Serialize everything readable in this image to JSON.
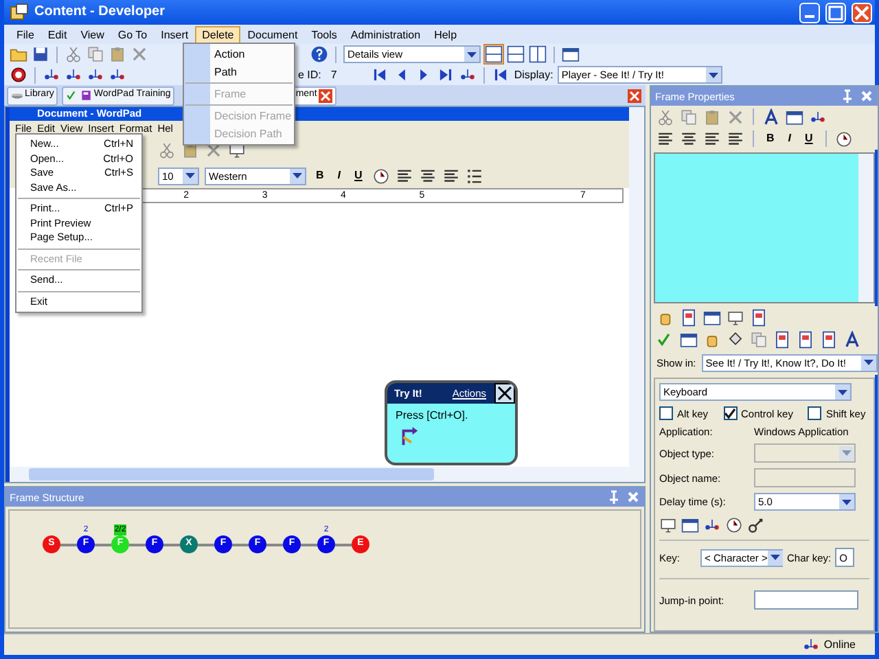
{
  "window": {
    "title": "Content - Developer"
  },
  "menu": [
    {
      "label": "File",
      "selected": false
    },
    {
      "label": "Edit",
      "selected": false
    },
    {
      "label": "View",
      "selected": false
    },
    {
      "label": "Go To",
      "selected": false
    },
    {
      "label": "Insert",
      "selected": false
    },
    {
      "label": "Delete",
      "selected": true
    },
    {
      "label": "Document",
      "selected": false
    },
    {
      "label": "Tools",
      "selected": false
    },
    {
      "label": "Administration",
      "selected": false
    },
    {
      "label": "Help",
      "selected": false
    }
  ],
  "delete_menu": [
    {
      "kind": "item",
      "label": "Action",
      "disabled": false
    },
    {
      "kind": "item",
      "label": "Path",
      "disabled": false
    },
    {
      "kind": "separator"
    },
    {
      "kind": "item",
      "label": "Frame",
      "disabled": true
    },
    {
      "kind": "separator"
    },
    {
      "kind": "item",
      "label": "Decision Frame",
      "disabled": true
    },
    {
      "kind": "item",
      "label": "Decision Path",
      "disabled": true
    }
  ],
  "toolbar": {
    "view_select": "Details view"
  },
  "toolbar2": {
    "id_label": "e ID:",
    "id_value": "7",
    "display_label": "Display:",
    "display_value": "Player - See It! / Try It!"
  },
  "nav_buttons": [
    "Library",
    "WordPad Training"
  ],
  "document_tab": {
    "label": "ment"
  },
  "wordpad": {
    "title": "Document - WordPad",
    "menu": [
      "File",
      "Edit",
      "View",
      "Insert",
      "Format",
      "Hel"
    ],
    "file_menu": [
      {
        "kind": "item",
        "label": "New...",
        "shortcut": "Ctrl+N",
        "disabled": false
      },
      {
        "kind": "item",
        "label": "Open...",
        "shortcut": "Ctrl+O",
        "disabled": false
      },
      {
        "kind": "item",
        "label": "Save",
        "shortcut": "Ctrl+S",
        "disabled": false
      },
      {
        "kind": "item",
        "label": "Save As...",
        "disabled": false
      },
      {
        "kind": "separator"
      },
      {
        "kind": "item",
        "label": "Print...",
        "shortcut": "Ctrl+P",
        "disabled": false
      },
      {
        "kind": "item",
        "label": "Print Preview",
        "disabled": false
      },
      {
        "kind": "item",
        "label": "Page Setup...",
        "disabled": false
      },
      {
        "kind": "separator"
      },
      {
        "kind": "item",
        "label": "Recent File",
        "disabled": true
      },
      {
        "kind": "separator"
      },
      {
        "kind": "item",
        "label": "Send...",
        "disabled": false
      },
      {
        "kind": "separator"
      },
      {
        "kind": "item",
        "label": "Exit",
        "disabled": false
      }
    ],
    "font_size": "10",
    "script": "Western",
    "format_buttons": [
      "B",
      "I",
      "U"
    ],
    "ruler": [
      "2",
      "3",
      "4",
      "5",
      "7"
    ]
  },
  "bubble": {
    "title": "Try It!",
    "link": "Actions",
    "text": "Press [Ctrl+O]."
  },
  "frame_structure": {
    "title": "Frame Structure",
    "nodes": [
      {
        "label": "S",
        "color": "#ee1111"
      },
      {
        "label": "F",
        "color": "#0a0ae6",
        "badge": "2",
        "badge_highlighted": false
      },
      {
        "label": "F",
        "color": "#22e022",
        "badge": "2/2",
        "badge_highlighted": true
      },
      {
        "label": "F",
        "color": "#0a0ae6"
      },
      {
        "label": "X",
        "color": "#0a7a70"
      },
      {
        "label": "F",
        "color": "#0a0ae6"
      },
      {
        "label": "F",
        "color": "#0a0ae6"
      },
      {
        "label": "F",
        "color": "#0a0ae6"
      },
      {
        "label": "F",
        "color": "#0a0ae6",
        "badge": "2",
        "badge_highlighted": false
      },
      {
        "label": "E",
        "color": "#ee1111"
      }
    ]
  },
  "frame_properties": {
    "title": "Frame Properties",
    "format_buttons": [
      "B",
      "I",
      "U"
    ],
    "show_in_label": "Show in:",
    "show_in": "See It! / Try It!, Know It?, Do It!",
    "action_type": "Keyboard",
    "modifiers": [
      {
        "label": "Alt key",
        "checked": false
      },
      {
        "label": "Control key",
        "checked": true
      },
      {
        "label": "Shift key",
        "checked": false
      }
    ],
    "application_label": "Application:",
    "application": "Windows Application",
    "object_type_label": "Object type:",
    "object_name_label": "Object name:",
    "delay_label": "Delay time (s):",
    "delay": "5.0",
    "key_label": "Key:",
    "key": "< Character >",
    "char_key_label": "Char key:",
    "char_key": "O",
    "jump_label": "Jump-in point:"
  },
  "status_bar": {
    "text": "Online"
  }
}
